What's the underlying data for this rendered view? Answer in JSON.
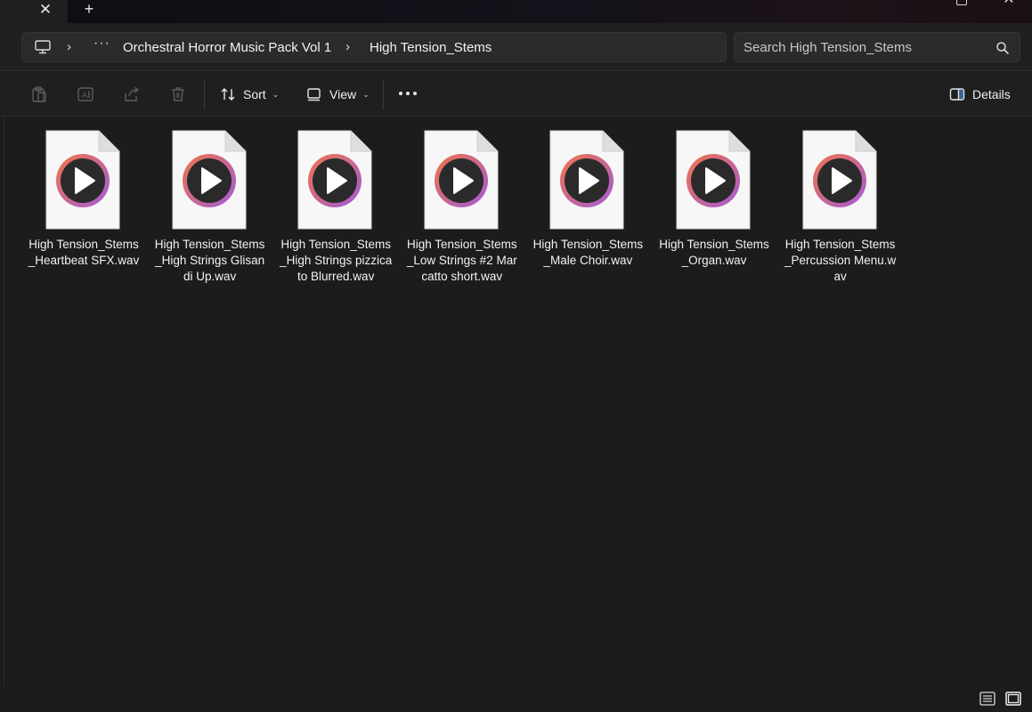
{
  "window": {
    "tab_close_glyph": "✕",
    "new_tab_glyph": "+"
  },
  "address": {
    "more_glyph": "···",
    "separator_glyph": "›",
    "crumbs": [
      "Orchestral Horror Music Pack Vol 1",
      "High Tension_Stems"
    ]
  },
  "search": {
    "placeholder": "Search High Tension_Stems",
    "value": ""
  },
  "toolbar": {
    "sort_label": "Sort",
    "view_label": "View",
    "details_label": "Details",
    "chevron_glyph": "⌄"
  },
  "files": [
    {
      "name": "High Tension_Stems_Heartbeat SFX.wav"
    },
    {
      "name": "High Tension_Stems_High Strings Glisandi Up.wav"
    },
    {
      "name": "High Tension_Stems_High Strings pizzicato Blurred.wav"
    },
    {
      "name": "High Tension_Stems_Low Strings #2 Marcatto short.wav"
    },
    {
      "name": "High Tension_Stems_Male Choir.wav"
    },
    {
      "name": "High Tension_Stems_Organ.wav"
    },
    {
      "name": "High Tension_Stems_Percussion Menu.wav"
    }
  ],
  "icons": {
    "file": "audio-file-icon",
    "accent_orange": "#f0744a",
    "accent_purple": "#a35bd6"
  }
}
